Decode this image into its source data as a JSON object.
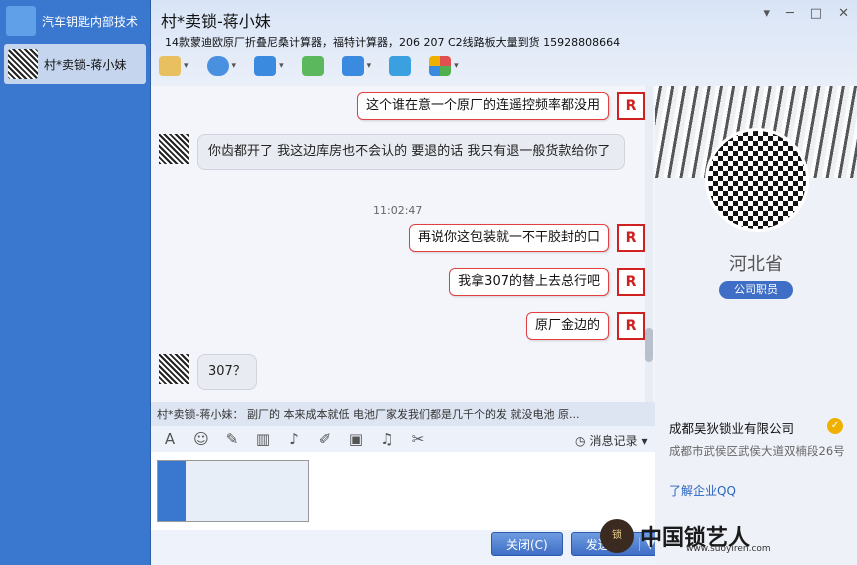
{
  "sidebar": {
    "items": [
      {
        "label": "汽车钥匙内部技术"
      },
      {
        "label": "村*卖锁-蒋小妹"
      }
    ]
  },
  "header": {
    "title": "村*卖锁-蒋小妹",
    "signature": "14款蒙迪欧原厂折叠尼桑计算器，福特计算器，206 207 C2线路板大量到货 15928808664"
  },
  "messages": {
    "m1": "这个谁在意一个原厂的连遥控频率都没用",
    "m2": "你齿都开了 我这边库房也不会认的 要退的话 我只有退一般货款给你了",
    "timestamp": "11:02:47",
    "m3": "再说你这包装就一不干胶封的口",
    "m4": "我拿307的替上去总行吧",
    "m5": "原厂金边的",
    "m6": "307？"
  },
  "preview_text": "村*卖锁-蒋小妹： 副厂的 本来成本就低 电池厂家发我们都是几千个的发 就没电池 原...",
  "history_label": "消息记录",
  "buttons": {
    "close": "关闭(C)",
    "send": "发送(S)"
  },
  "profile": {
    "province": "河北省",
    "role": "公司职员",
    "company": "成都吴狄锁业有限公司",
    "address": "成都市武侯区武侯大道双楠段26号",
    "qq_link": "了解企业QQ"
  },
  "watermark": {
    "text": "中国锁艺人",
    "url": "www.suoyiren.com"
  }
}
